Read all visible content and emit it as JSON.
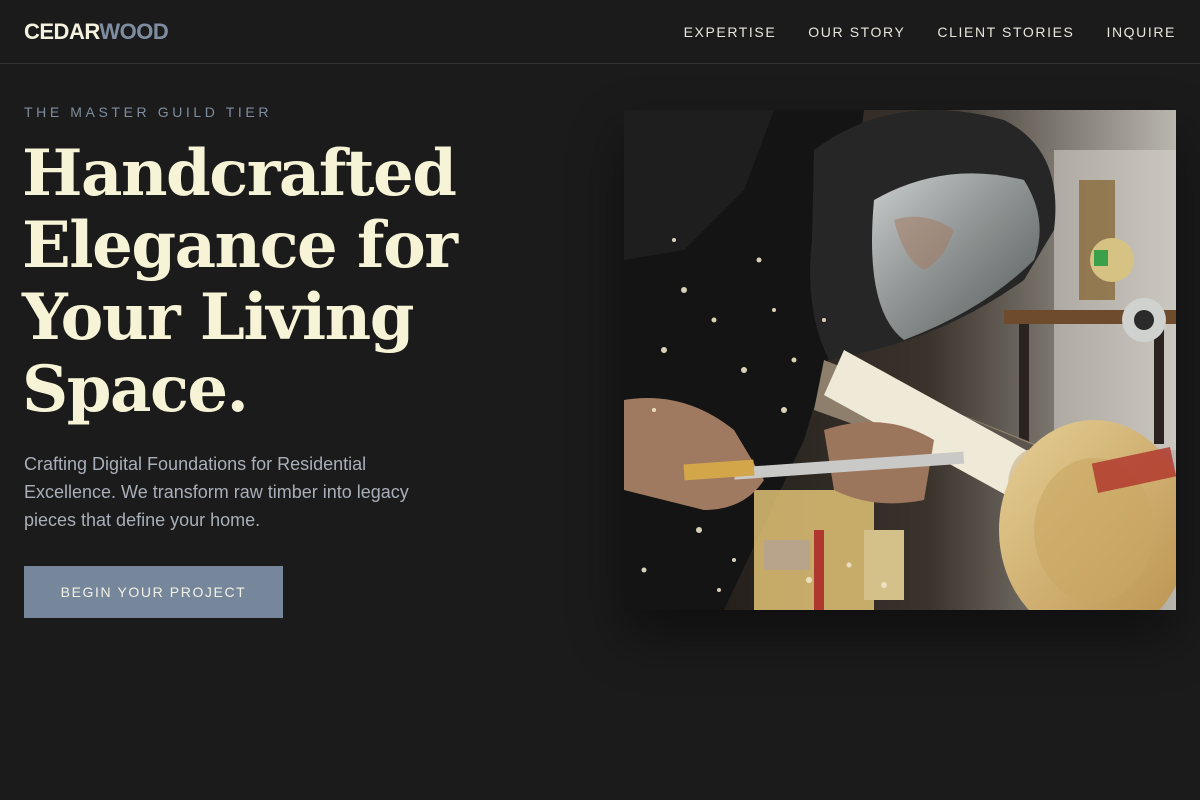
{
  "brand": {
    "part1": "CEDAR",
    "part2": "WOOD"
  },
  "nav": {
    "items": [
      {
        "label": "EXPERTISE"
      },
      {
        "label": "OUR STORY"
      },
      {
        "label": "CLIENT STORIES"
      },
      {
        "label": "INQUIRE"
      }
    ]
  },
  "hero": {
    "eyebrow": "THE MASTER GUILD TIER",
    "headline_line1": "Handcrafted",
    "headline_line2": "Elegance for",
    "headline_line3": "Your Living",
    "headline_line4": "Space.",
    "lede": "Crafting Digital Foundations for Residential Excellence. We transform raw timber into legacy pieces that define your home.",
    "cta_label": "BEGIN YOUR PROJECT"
  },
  "colors": {
    "background": "#1b1b1b",
    "cream": "#f6f3d6",
    "slate_accent": "#76869b",
    "muted_text": "#a9afb8"
  }
}
